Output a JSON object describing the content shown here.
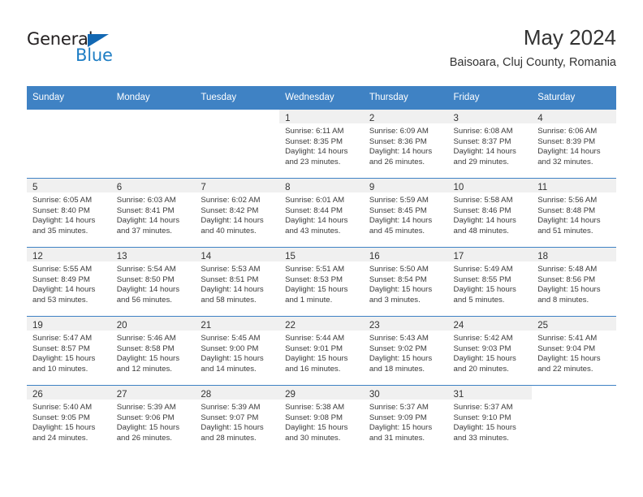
{
  "brand": {
    "name_top": "General",
    "name_bottom": "Blue",
    "triangle_color": "#1268b3",
    "blue_color": "#1f7ec4"
  },
  "header": {
    "title": "May 2024",
    "subtitle": "Baisoara, Cluj County, Romania"
  },
  "theme": {
    "header_blue": "#3f82c4",
    "row_shade": "#f0f0f0",
    "text": "#333333"
  },
  "weekdays": [
    "Sunday",
    "Monday",
    "Tuesday",
    "Wednesday",
    "Thursday",
    "Friday",
    "Saturday"
  ],
  "weeks": [
    [
      {
        "day": "",
        "sunrise": "",
        "sunset": "",
        "daylight1": "",
        "daylight2": ""
      },
      {
        "day": "",
        "sunrise": "",
        "sunset": "",
        "daylight1": "",
        "daylight2": ""
      },
      {
        "day": "",
        "sunrise": "",
        "sunset": "",
        "daylight1": "",
        "daylight2": ""
      },
      {
        "day": "1",
        "sunrise": "Sunrise: 6:11 AM",
        "sunset": "Sunset: 8:35 PM",
        "daylight1": "Daylight: 14 hours",
        "daylight2": "and 23 minutes."
      },
      {
        "day": "2",
        "sunrise": "Sunrise: 6:09 AM",
        "sunset": "Sunset: 8:36 PM",
        "daylight1": "Daylight: 14 hours",
        "daylight2": "and 26 minutes."
      },
      {
        "day": "3",
        "sunrise": "Sunrise: 6:08 AM",
        "sunset": "Sunset: 8:37 PM",
        "daylight1": "Daylight: 14 hours",
        "daylight2": "and 29 minutes."
      },
      {
        "day": "4",
        "sunrise": "Sunrise: 6:06 AM",
        "sunset": "Sunset: 8:39 PM",
        "daylight1": "Daylight: 14 hours",
        "daylight2": "and 32 minutes."
      }
    ],
    [
      {
        "day": "5",
        "sunrise": "Sunrise: 6:05 AM",
        "sunset": "Sunset: 8:40 PM",
        "daylight1": "Daylight: 14 hours",
        "daylight2": "and 35 minutes."
      },
      {
        "day": "6",
        "sunrise": "Sunrise: 6:03 AM",
        "sunset": "Sunset: 8:41 PM",
        "daylight1": "Daylight: 14 hours",
        "daylight2": "and 37 minutes."
      },
      {
        "day": "7",
        "sunrise": "Sunrise: 6:02 AM",
        "sunset": "Sunset: 8:42 PM",
        "daylight1": "Daylight: 14 hours",
        "daylight2": "and 40 minutes."
      },
      {
        "day": "8",
        "sunrise": "Sunrise: 6:01 AM",
        "sunset": "Sunset: 8:44 PM",
        "daylight1": "Daylight: 14 hours",
        "daylight2": "and 43 minutes."
      },
      {
        "day": "9",
        "sunrise": "Sunrise: 5:59 AM",
        "sunset": "Sunset: 8:45 PM",
        "daylight1": "Daylight: 14 hours",
        "daylight2": "and 45 minutes."
      },
      {
        "day": "10",
        "sunrise": "Sunrise: 5:58 AM",
        "sunset": "Sunset: 8:46 PM",
        "daylight1": "Daylight: 14 hours",
        "daylight2": "and 48 minutes."
      },
      {
        "day": "11",
        "sunrise": "Sunrise: 5:56 AM",
        "sunset": "Sunset: 8:48 PM",
        "daylight1": "Daylight: 14 hours",
        "daylight2": "and 51 minutes."
      }
    ],
    [
      {
        "day": "12",
        "sunrise": "Sunrise: 5:55 AM",
        "sunset": "Sunset: 8:49 PM",
        "daylight1": "Daylight: 14 hours",
        "daylight2": "and 53 minutes."
      },
      {
        "day": "13",
        "sunrise": "Sunrise: 5:54 AM",
        "sunset": "Sunset: 8:50 PM",
        "daylight1": "Daylight: 14 hours",
        "daylight2": "and 56 minutes."
      },
      {
        "day": "14",
        "sunrise": "Sunrise: 5:53 AM",
        "sunset": "Sunset: 8:51 PM",
        "daylight1": "Daylight: 14 hours",
        "daylight2": "and 58 minutes."
      },
      {
        "day": "15",
        "sunrise": "Sunrise: 5:51 AM",
        "sunset": "Sunset: 8:53 PM",
        "daylight1": "Daylight: 15 hours",
        "daylight2": "and 1 minute."
      },
      {
        "day": "16",
        "sunrise": "Sunrise: 5:50 AM",
        "sunset": "Sunset: 8:54 PM",
        "daylight1": "Daylight: 15 hours",
        "daylight2": "and 3 minutes."
      },
      {
        "day": "17",
        "sunrise": "Sunrise: 5:49 AM",
        "sunset": "Sunset: 8:55 PM",
        "daylight1": "Daylight: 15 hours",
        "daylight2": "and 5 minutes."
      },
      {
        "day": "18",
        "sunrise": "Sunrise: 5:48 AM",
        "sunset": "Sunset: 8:56 PM",
        "daylight1": "Daylight: 15 hours",
        "daylight2": "and 8 minutes."
      }
    ],
    [
      {
        "day": "19",
        "sunrise": "Sunrise: 5:47 AM",
        "sunset": "Sunset: 8:57 PM",
        "daylight1": "Daylight: 15 hours",
        "daylight2": "and 10 minutes."
      },
      {
        "day": "20",
        "sunrise": "Sunrise: 5:46 AM",
        "sunset": "Sunset: 8:58 PM",
        "daylight1": "Daylight: 15 hours",
        "daylight2": "and 12 minutes."
      },
      {
        "day": "21",
        "sunrise": "Sunrise: 5:45 AM",
        "sunset": "Sunset: 9:00 PM",
        "daylight1": "Daylight: 15 hours",
        "daylight2": "and 14 minutes."
      },
      {
        "day": "22",
        "sunrise": "Sunrise: 5:44 AM",
        "sunset": "Sunset: 9:01 PM",
        "daylight1": "Daylight: 15 hours",
        "daylight2": "and 16 minutes."
      },
      {
        "day": "23",
        "sunrise": "Sunrise: 5:43 AM",
        "sunset": "Sunset: 9:02 PM",
        "daylight1": "Daylight: 15 hours",
        "daylight2": "and 18 minutes."
      },
      {
        "day": "24",
        "sunrise": "Sunrise: 5:42 AM",
        "sunset": "Sunset: 9:03 PM",
        "daylight1": "Daylight: 15 hours",
        "daylight2": "and 20 minutes."
      },
      {
        "day": "25",
        "sunrise": "Sunrise: 5:41 AM",
        "sunset": "Sunset: 9:04 PM",
        "daylight1": "Daylight: 15 hours",
        "daylight2": "and 22 minutes."
      }
    ],
    [
      {
        "day": "26",
        "sunrise": "Sunrise: 5:40 AM",
        "sunset": "Sunset: 9:05 PM",
        "daylight1": "Daylight: 15 hours",
        "daylight2": "and 24 minutes."
      },
      {
        "day": "27",
        "sunrise": "Sunrise: 5:39 AM",
        "sunset": "Sunset: 9:06 PM",
        "daylight1": "Daylight: 15 hours",
        "daylight2": "and 26 minutes."
      },
      {
        "day": "28",
        "sunrise": "Sunrise: 5:39 AM",
        "sunset": "Sunset: 9:07 PM",
        "daylight1": "Daylight: 15 hours",
        "daylight2": "and 28 minutes."
      },
      {
        "day": "29",
        "sunrise": "Sunrise: 5:38 AM",
        "sunset": "Sunset: 9:08 PM",
        "daylight1": "Daylight: 15 hours",
        "daylight2": "and 30 minutes."
      },
      {
        "day": "30",
        "sunrise": "Sunrise: 5:37 AM",
        "sunset": "Sunset: 9:09 PM",
        "daylight1": "Daylight: 15 hours",
        "daylight2": "and 31 minutes."
      },
      {
        "day": "31",
        "sunrise": "Sunrise: 5:37 AM",
        "sunset": "Sunset: 9:10 PM",
        "daylight1": "Daylight: 15 hours",
        "daylight2": "and 33 minutes."
      },
      {
        "day": "",
        "sunrise": "",
        "sunset": "",
        "daylight1": "",
        "daylight2": ""
      }
    ]
  ]
}
